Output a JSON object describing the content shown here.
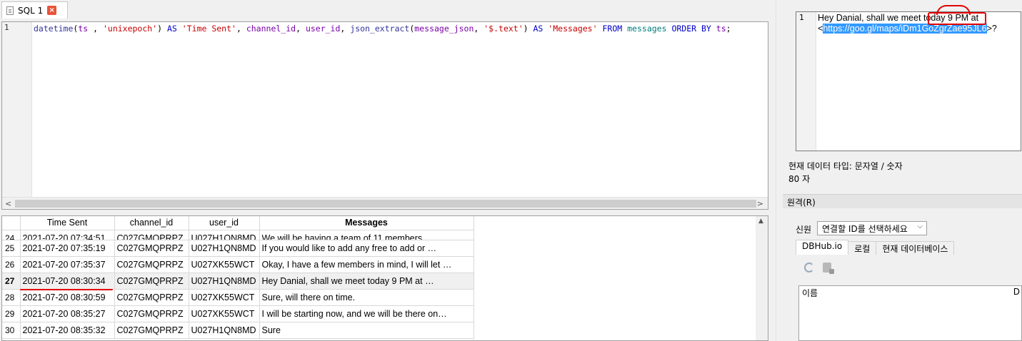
{
  "tab": {
    "label": "SQL 1"
  },
  "editor": {
    "line_number": "1",
    "sql": {
      "t1": "datetime",
      "t2": "(",
      "t3": "ts",
      "t4": " , ",
      "t5": "'unixepoch'",
      "t6": ") ",
      "t7": "AS",
      "t8": " ",
      "t9": "'Time Sent'",
      "t10": ", ",
      "t11": "channel_id",
      "t12": ", ",
      "t13": "user_id",
      "t14": ", ",
      "t15": "json_extract",
      "t16": "(",
      "t17": "message_json",
      "t18": ", ",
      "t19": "'$.text'",
      "t20": ") ",
      "t21": "AS",
      "t22": " ",
      "t23": "'Messages'",
      "t24": " ",
      "t25": "FROM",
      "t26": " ",
      "t27": "messages",
      "t28": " ",
      "t29": "ORDER BY",
      "t30": " ",
      "t31": "ts",
      "t32": ";"
    }
  },
  "results": {
    "columns": [
      "Time Sent",
      "channel_id",
      "user_id",
      "Messages"
    ],
    "rows": [
      {
        "num": "24",
        "time": "2021-07-20 07:34:51",
        "channel": "C027GMQPRPZ",
        "user": "U027H1QN8MD",
        "msg": "We will be having a team of 11 members …"
      },
      {
        "num": "25",
        "time": "2021-07-20 07:35:19",
        "channel": "C027GMQPRPZ",
        "user": "U027H1QN8MD",
        "msg": "If you would like to add any free to add or …"
      },
      {
        "num": "26",
        "time": "2021-07-20 07:35:37",
        "channel": "C027GMQPRPZ",
        "user": "U027XK55WCT",
        "msg": "Okay, I have a few members in mind, I will let …"
      },
      {
        "num": "27",
        "time": "2021-07-20 08:30:34",
        "channel": "C027GMQPRPZ",
        "user": "U027H1QN8MD",
        "msg": "Hey Danial, shall we meet today 9 PM at …"
      },
      {
        "num": "28",
        "time": "2021-07-20 08:30:59",
        "channel": "C027GMQPRPZ",
        "user": "U027XK55WCT",
        "msg": "Sure, will there on time."
      },
      {
        "num": "29",
        "time": "2021-07-20 08:35:27",
        "channel": "C027GMQPRPZ",
        "user": "U027XK55WCT",
        "msg": "I will be starting now, and we will be there on…"
      },
      {
        "num": "30",
        "time": "2021-07-20 08:35:32",
        "channel": "C027GMQPRPZ",
        "user": "U027H1QN8MD",
        "msg": "Sure"
      }
    ]
  },
  "cell_editor": {
    "line_number": "1",
    "line1_prefix": "Hey Danial, shall we meet today 9 PM at",
    "line2_open": "<",
    "line2_url": "https://goo.gl/maps/iDm1GoZgrZae95JL6",
    "line2_close": ">?"
  },
  "info": {
    "data_type": "현재 데이터 타입: 문자열 / 숫자",
    "char_count": "80 자"
  },
  "remote": {
    "header": "원격(R)",
    "identity_label": "신원",
    "identity_placeholder": "연결할 ID를 선택하세요",
    "tabs": [
      "DBHub.io",
      "로컬",
      "현재 데이터베이스"
    ],
    "list_column": "이름",
    "list_column2": "D"
  },
  "colors": {
    "annotation_red": "#e00000",
    "selection_blue": "#3399ff"
  }
}
